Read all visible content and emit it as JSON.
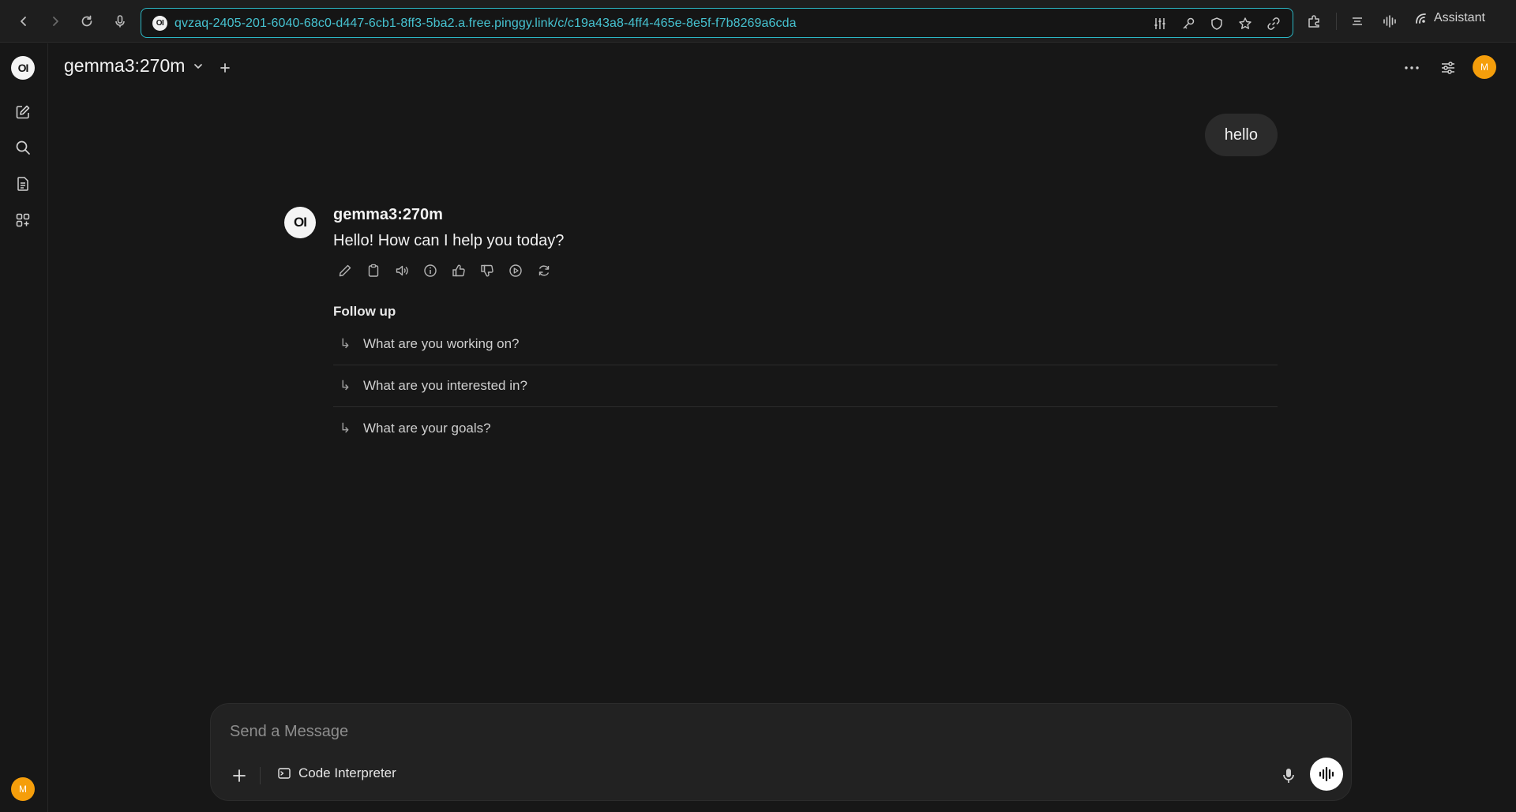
{
  "browser": {
    "url": "qvzaq-2405-201-6040-68c0-d447-6cb1-8ff3-5ba2.a.free.pinggy.link/c/c19a43a8-4ff4-465e-8e5f-f7b8269a6cda",
    "favicon_text": "OI",
    "assistant_label": "Assistant",
    "accent": "#46c3d1"
  },
  "sidebar": {
    "logo_text": "OI",
    "items": [
      {
        "icon": "new-chat-icon"
      },
      {
        "icon": "search-icon"
      },
      {
        "icon": "notes-icon"
      },
      {
        "icon": "workspace-icon"
      }
    ],
    "user_initial": "M"
  },
  "header": {
    "model_name": "gemma3:270m",
    "user_initial": "M"
  },
  "chat": {
    "user_message": "hello",
    "bot": {
      "avatar_text": "OI",
      "name": "gemma3:270m",
      "message": "Hello! How can I help you today?"
    },
    "followup_title": "Follow up",
    "followups": [
      "What are you working on?",
      "What are you interested in?",
      "What are your goals?"
    ]
  },
  "composer": {
    "placeholder": "Send a Message",
    "code_interpreter_label": "Code Interpreter"
  },
  "colors": {
    "background": "#171717",
    "avatar": "#f59e0b"
  }
}
